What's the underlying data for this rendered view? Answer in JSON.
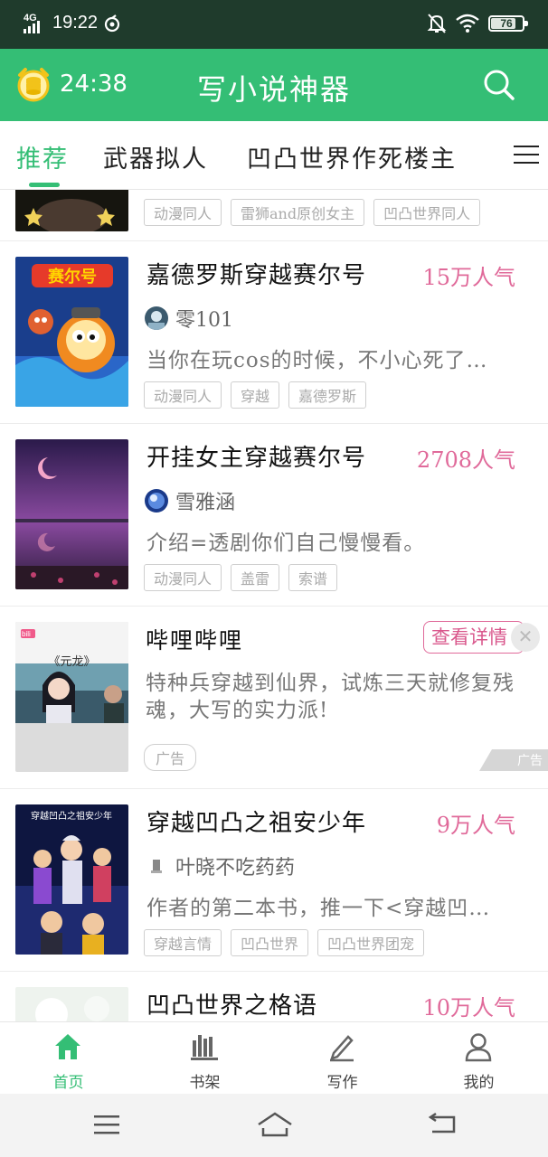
{
  "status_bar": {
    "network": "4G",
    "time": "19:22",
    "battery": "76"
  },
  "app_bar": {
    "timer": "24:38",
    "title": "写小说神器"
  },
  "tabs": [
    {
      "label": "推荐"
    },
    {
      "label": "武器拟人"
    },
    {
      "label": "凹凸世界作死楼主"
    }
  ],
  "partial_card": {
    "tags": [
      "动漫同人",
      "雷狮and原创女主",
      "凹凸世界同人"
    ]
  },
  "books": [
    {
      "title": "嘉德罗斯穿越赛尔号",
      "popularity": "15万人气",
      "author": "零101",
      "description": "当你在玩cos的时候，不小心死了…",
      "tags": [
        "动漫同人",
        "穿越",
        "嘉德罗斯"
      ]
    },
    {
      "title": "开挂女主穿越赛尔号",
      "popularity": "2708人气",
      "author": "雪雅涵",
      "description": "介绍=透剧你们自己慢慢看。",
      "tags": [
        "动漫同人",
        "盖雷",
        "索谱"
      ]
    }
  ],
  "ad": {
    "title": "哔哩哔哩",
    "button": "查看详情",
    "description": "特种兵穿越到仙界，试炼三天就修复残魂，大写的实力派!",
    "tag": "广告",
    "corner_label": "广告",
    "cover_caption": "《元龙》",
    "cover_badge": "bili"
  },
  "books2": [
    {
      "title": "穿越凹凸之祖安少年",
      "popularity": "9万人气",
      "author": "叶晓不吃药药",
      "description": "作者的第二本书，推一下<穿越凹…",
      "tags": [
        "穿越言情",
        "凹凸世界",
        "凹凸世界团宠"
      ]
    },
    {
      "title": "凹凸世界之格语",
      "popularity": "10万人气"
    }
  ],
  "bottom_nav": [
    {
      "label": "首页",
      "icon": "home-icon"
    },
    {
      "label": "书架",
      "icon": "bookshelf-icon"
    },
    {
      "label": "写作",
      "icon": "pen-icon"
    },
    {
      "label": "我的",
      "icon": "profile-icon"
    }
  ],
  "colors": {
    "accent": "#34be75",
    "status_bar": "#1f3b2c",
    "popularity": "#e06a9a"
  }
}
